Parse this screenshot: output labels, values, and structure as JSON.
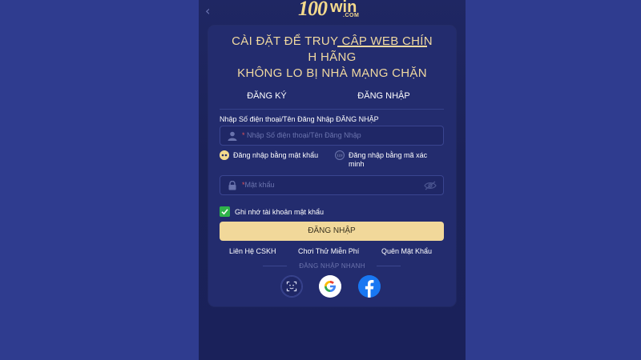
{
  "brand": {
    "logo_num": "100",
    "logo_win": "win",
    "logo_com": ".COM"
  },
  "nav": {
    "back_icon": "chevron-left-icon"
  },
  "headline": {
    "line1": "CÀI ĐẶT ĐỂ TRUY CẬP WEB CHÍN",
    "line2": "H HÃNG",
    "line3": "KHÔNG LO BỊ NHÀ MẠNG CHẶN"
  },
  "tabs": {
    "register": "ĐĂNG KÝ",
    "login": "ĐĂNG NHẬP",
    "active": "login"
  },
  "form": {
    "username_label": "Nhập Số điện thoại/Tên Đăng Nhập ĐĂNG NHẬP",
    "username_placeholder": "Nhập Số điện thoại/Tên Đăng Nhập",
    "required_mark": "*",
    "login_with_password": "Đăng nhập bằng mật khẩu",
    "login_with_code": "Đăng nhập bằng mã xác minh",
    "password_placeholder": "Mật khẩu",
    "remember_label": "Ghi nhớ tài khoản mật khẩu",
    "remember_checked": true,
    "submit_label": "ĐĂNG NHẬP"
  },
  "links": {
    "support": "Liên Hệ CSKH",
    "trial": "Chơi Thử Miễn Phí",
    "forgot": "Quên Mật Khẩu"
  },
  "quick_login": {
    "title": "ĐĂNG NHẬP NHANH",
    "providers": [
      "face-id-icon",
      "google-icon",
      "facebook-icon"
    ]
  },
  "colors": {
    "page_bg": "#2f3c8f",
    "panel_bg": "#1f2763",
    "card_bg": "#232c6e",
    "gold": "#f0d9a0",
    "check_green": "#2fb34a",
    "facebook_blue": "#1877f2"
  }
}
